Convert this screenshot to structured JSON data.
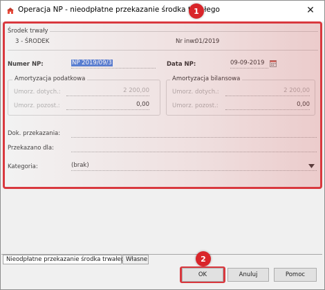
{
  "window": {
    "title": "Operacja NP - nieodpłatne przekazanie środka trwałego",
    "close_glyph": "✕"
  },
  "badges": {
    "first": "1",
    "second": "2"
  },
  "asset": {
    "section_label": "Środek trwały",
    "name": "3 - ŚRODEK",
    "inv_label": "Nr inw:",
    "inv_value": "01/2019"
  },
  "numer_np": {
    "label": "Numer NP:",
    "value": "NP 2019/09/3"
  },
  "data_np": {
    "label": "Data NP:",
    "value": "09-09-2019"
  },
  "amort_podatkowa": {
    "title": "Amortyzacja podatkowa",
    "row1_label": "Umorz. dotych.:",
    "row1_value": "2 200,00",
    "row2_label": "Umorz. pozost.:",
    "row2_value": "0,00"
  },
  "amort_bilansowa": {
    "title": "Amortyzacja bilansowa",
    "row1_label": "Umorz. dotych.:",
    "row1_value": "2 200,00",
    "row2_label": "Umorz. pozost.:",
    "row2_value": "0,00"
  },
  "dok_przekazania": {
    "label": "Dok. przekazania:",
    "value": ""
  },
  "przekazano_dla": {
    "label": "Przekazano dla:",
    "value": ""
  },
  "kategoria": {
    "label": "Kategoria:",
    "value": "(brak)"
  },
  "tabs": [
    {
      "label": "Nieodpłatne przekazanie środka trwałego"
    },
    {
      "label": "Własne"
    }
  ],
  "buttons": {
    "ok": "OK",
    "cancel": "Anuluj",
    "help": "Pomoc"
  },
  "colors": {
    "accent_red": "#d9252a",
    "selection_blue": "#3b6fd1"
  },
  "icons": [
    "app-icon",
    "close-icon",
    "calendar-icon",
    "dropdown-arrow-icon"
  ]
}
